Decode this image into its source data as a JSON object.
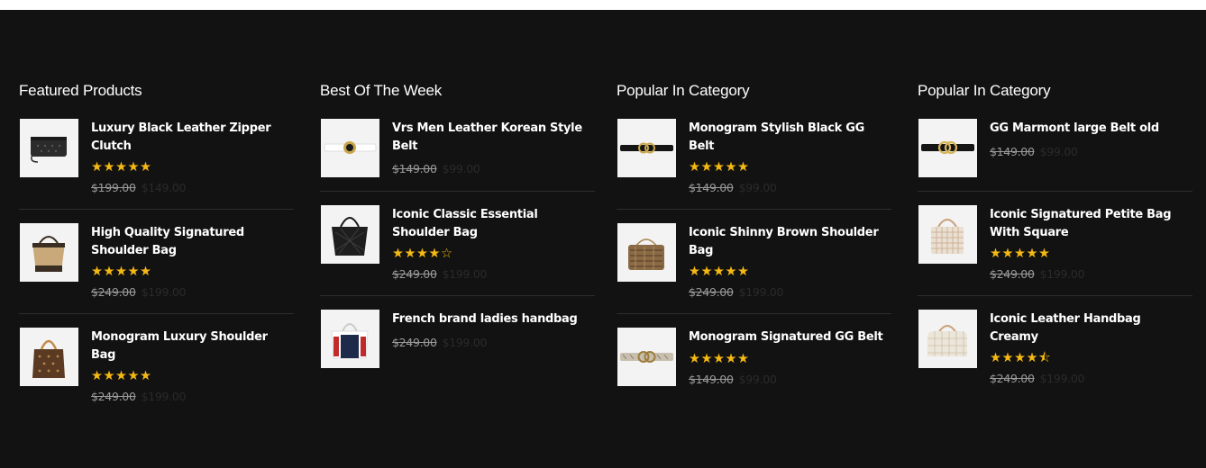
{
  "columns": [
    {
      "title": "Featured Products",
      "products": [
        {
          "name": "Luxury Black Leather Zipper Clutch",
          "stars": "★★★★★",
          "old_price": "$199.00",
          "new_price": "$149.00",
          "image": "black-clutch-image"
        },
        {
          "name": "High Quality Signatured Shoulder Bag",
          "stars": "★★★★★",
          "old_price": "$249.00",
          "new_price": "$199.00",
          "image": "tan-shoulder-bag-image"
        },
        {
          "name": "Monogram Luxury Shoulder Bag",
          "stars": "★★★★★",
          "old_price": "$249.00",
          "new_price": "$199.00",
          "image": "monogram-brown-bag-image"
        }
      ]
    },
    {
      "title": "Best Of The Week",
      "products": [
        {
          "name": "Vrs Men Leather Korean Style Belt",
          "stars": "",
          "old_price": "$149.00",
          "new_price": "$99.00",
          "image": "white-belt-image"
        },
        {
          "name": "Iconic Classic Essential Shoulder Bag",
          "stars": "★★★★☆",
          "old_price": "$249.00",
          "new_price": "$199.00",
          "image": "black-tote-image"
        },
        {
          "name": "French brand ladies handbag",
          "stars": "",
          "old_price": "$249.00",
          "new_price": "$199.00",
          "image": "tricolor-handbag-image"
        }
      ]
    },
    {
      "title": "Popular In Category",
      "products": [
        {
          "name": "Monogram Stylish Black GG Belt",
          "stars": "★★★★★",
          "old_price": "$149.00",
          "new_price": "$99.00",
          "image": "black-gg-belt-image"
        },
        {
          "name": "Iconic Shinny Brown Shoulder Bag",
          "stars": "★★★★★",
          "old_price": "$249.00",
          "new_price": "$199.00",
          "image": "brown-python-bag-image"
        },
        {
          "name": "Monogram Signatured GG Belt",
          "stars": "★★★★★",
          "old_price": "$149.00",
          "new_price": "$99.00",
          "image": "monogram-gg-belt-image"
        }
      ]
    },
    {
      "title": "Popular In Category",
      "products": [
        {
          "name": "GG Marmont large Belt old",
          "stars": "",
          "old_price": "$149.00",
          "new_price": "$99.00",
          "image": "marmont-belt-image"
        },
        {
          "name": "Iconic Signatured Petite Bag With Square",
          "stars": "★★★★★",
          "old_price": "$249.00",
          "new_price": "$199.00",
          "image": "checkered-petite-bag-image"
        },
        {
          "name": "Iconic Leather Handbag Creamy",
          "stars": "★★★★⯪",
          "old_price": "$249.00",
          "new_price": "$199.00",
          "image": "creamy-speedy-bag-image"
        }
      ]
    }
  ],
  "colors": {
    "background": "#121212",
    "star": "#f5b914",
    "old_price": "#9a9a9a",
    "new_price": "#2a2a2a"
  }
}
